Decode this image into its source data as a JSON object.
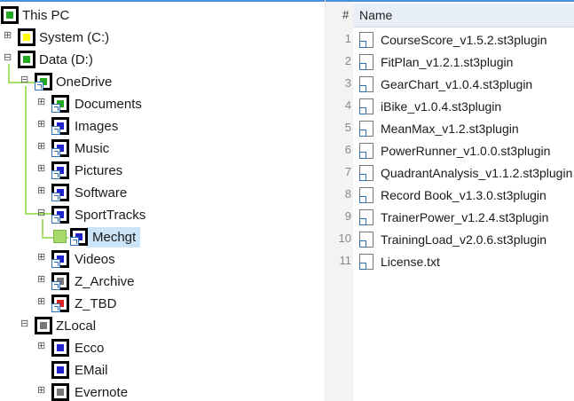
{
  "tree": {
    "items": [
      {
        "label": "This PC",
        "core_color": "#22aa22",
        "icon": "pc-icon"
      },
      {
        "label": "System (C:)",
        "core_color": "#ffff00",
        "icon": "drive-icon"
      },
      {
        "label": "Data (D:)",
        "core_color": "#22aa22",
        "icon": "drive-icon"
      },
      {
        "label": "OneDrive",
        "core_color": "#22aa22",
        "icon": "folder-icon"
      },
      {
        "label": "Documents",
        "core_color": "#22aa22",
        "icon": "folder-icon"
      },
      {
        "label": "Images",
        "core_color": "#2222cc",
        "icon": "folder-icon"
      },
      {
        "label": "Music",
        "core_color": "#2222cc",
        "icon": "folder-icon"
      },
      {
        "label": "Pictures",
        "core_color": "#2222cc",
        "icon": "folder-icon"
      },
      {
        "label": "Software",
        "core_color": "#2222cc",
        "icon": "folder-icon"
      },
      {
        "label": "SportTracks",
        "core_color": "#2222cc",
        "icon": "folder-icon"
      },
      {
        "label": "Mechgt",
        "core_color": "#2222cc",
        "icon": "folder-icon"
      },
      {
        "label": "Videos",
        "core_color": "#2222cc",
        "icon": "folder-icon"
      },
      {
        "label": "Z_Archive",
        "core_color": "#777777",
        "icon": "folder-icon"
      },
      {
        "label": "Z_TBD",
        "core_color": "#dd2222",
        "icon": "folder-icon"
      },
      {
        "label": "ZLocal",
        "core_color": "#777777",
        "icon": "folder-icon"
      },
      {
        "label": "Ecco",
        "core_color": "#2222cc",
        "icon": "folder-icon"
      },
      {
        "label": "EMail",
        "core_color": "#2222cc",
        "icon": "folder-icon"
      },
      {
        "label": "Evernote",
        "core_color": "#777777",
        "icon": "folder-icon"
      }
    ]
  },
  "list": {
    "header": {
      "hash": "#",
      "name": "Name"
    },
    "files": [
      {
        "num": "1",
        "name": "CourseScore_v1.5.2.st3plugin"
      },
      {
        "num": "2",
        "name": "FitPlan_v1.2.1.st3plugin"
      },
      {
        "num": "3",
        "name": "GearChart_v1.0.4.st3plugin"
      },
      {
        "num": "4",
        "name": "iBike_v1.0.4.st3plugin"
      },
      {
        "num": "5",
        "name": "MeanMax_v1.2.st3plugin"
      },
      {
        "num": "6",
        "name": "PowerRunner_v1.0.0.st3plugin"
      },
      {
        "num": "7",
        "name": "QuadrantAnalysis_v1.1.2.st3plugin"
      },
      {
        "num": "8",
        "name": "Record Book_v1.3.0.st3plugin"
      },
      {
        "num": "9",
        "name": "TrainerPower_v1.2.4.st3plugin"
      },
      {
        "num": "10",
        "name": "TrainingLoad_v2.0.6.st3plugin"
      },
      {
        "num": "11",
        "name": "License.txt"
      }
    ]
  },
  "colors": {
    "selection": "#cce4f7",
    "tree_line": "#a8e06a",
    "accent": "#4a90d9"
  }
}
